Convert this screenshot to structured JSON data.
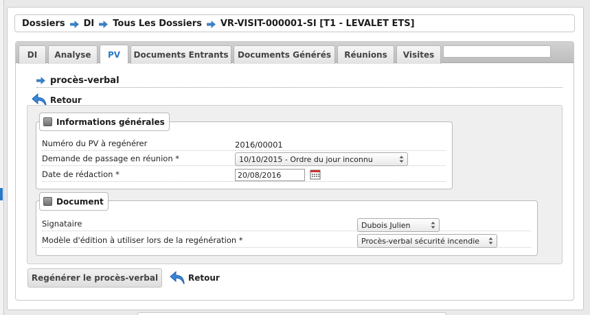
{
  "breadcrumb": {
    "items": [
      "Dossiers",
      "DI",
      "Tous Les Dossiers",
      "VR-VISIT-000001-SI [T1 - LEVALET ETS]"
    ]
  },
  "tabs": [
    {
      "label": "DI"
    },
    {
      "label": "Analyse"
    },
    {
      "label": "PV"
    },
    {
      "label": "Documents Entrants"
    },
    {
      "label": "Documents Générés"
    },
    {
      "label": "Réunions"
    },
    {
      "label": "Visites"
    }
  ],
  "active_tab": "PV",
  "tab_search": {
    "value": ""
  },
  "section": {
    "title": "procès-verbal"
  },
  "retour_label": "Retour",
  "fieldset_general": {
    "legend": "Informations générales",
    "rows": [
      {
        "label": "Numéro du PV à regénérer",
        "value": "2016/00001"
      },
      {
        "label": "Demande de passage en réunion *",
        "value": "10/10/2015 - Ordre du jour inconnu"
      },
      {
        "label": "Date de rédaction *",
        "value": "20/08/2016"
      }
    ]
  },
  "fieldset_document": {
    "legend": "Document",
    "rows": [
      {
        "label": "Signataire",
        "value": "Dubois Julien"
      },
      {
        "label": "Modèle d'édition à utiliser lors de la regénération *",
        "value": "Procès-verbal sécurité incendie"
      }
    ]
  },
  "actions": {
    "regenerate_label": "Regénérer le procès-verbal",
    "retour_label": "Retour"
  },
  "colors": {
    "accent": "#2a78c8",
    "arrow": "#3d7fc4"
  },
  "icons": {
    "breadcrumb_separator": "arrow-right-icon",
    "retour": "undo-arrow-icon",
    "calendar": "calendar-icon",
    "legend_toggle": "collapse-toggle-icon"
  }
}
